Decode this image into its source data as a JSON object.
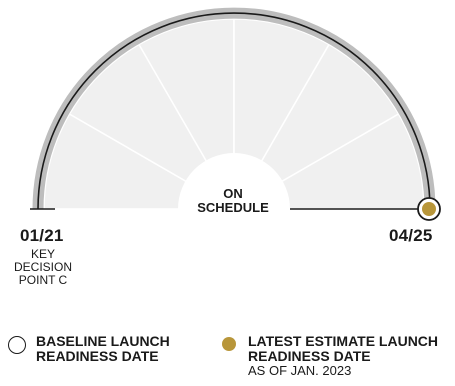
{
  "chart_data": {
    "type": "gauge",
    "center_label": [
      "ON",
      "SCHEDULE"
    ],
    "segments": 6,
    "baseline": {
      "date": "01/21",
      "note": [
        "KEY",
        "DECISION",
        "POINT C"
      ]
    },
    "latest": {
      "date": "04/25"
    },
    "legend": {
      "baseline_label": [
        "BASELINE LAUNCH",
        "READINESS DATE"
      ],
      "latest_label": [
        "LATEST ESTIMATE LAUNCH",
        "READINESS DATE"
      ],
      "latest_sub": "AS OF JAN. 2023"
    },
    "colors": {
      "fill": "#f0f0f0",
      "track": "#bdbdbd",
      "line": "#1a1a1a",
      "marker": "#b8963a"
    }
  }
}
